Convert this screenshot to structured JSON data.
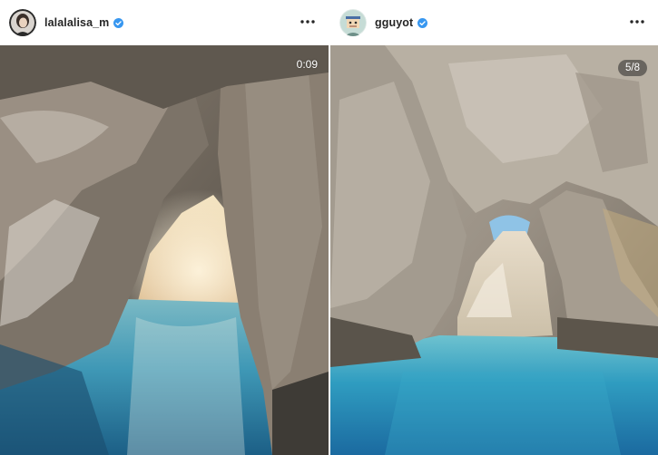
{
  "posts": [
    {
      "username": "lalalalisa_m",
      "verified": true,
      "media_overlay": "0:09",
      "media_type": "video",
      "more_icon": "ellipsis-icon"
    },
    {
      "username": "gguyot",
      "verified": true,
      "media_overlay": "5/8",
      "media_type": "carousel",
      "more_icon": "ellipsis-icon"
    }
  ],
  "colors": {
    "verified": "#3897f0",
    "username": "#262626"
  }
}
